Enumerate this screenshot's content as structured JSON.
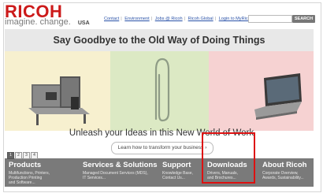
{
  "brand": {
    "logo": "RICOH",
    "tagline": "imagine. change.",
    "country": "USA",
    "logo_color": "#cc1a1a"
  },
  "topnav": {
    "links": [
      "Contact",
      "Environment",
      "Jobs @ Ricoh",
      "Ricoh Global",
      "Login to MyRicoh"
    ]
  },
  "search": {
    "value": "",
    "button_label": "SEARCH"
  },
  "headline": "Say Goodbye to the Old Way of Doing Things",
  "hero": {
    "slogan": "Unleash your Ideas in this New World of Work",
    "cta": "Learn how to transform your business",
    "cta_arrow": "›",
    "panel_colors": [
      "#f7f0cf",
      "#dce9c4",
      "#f6d2d2"
    ],
    "pages": [
      "1",
      "2",
      "3",
      "4"
    ],
    "active_page": "1"
  },
  "tiles": [
    {
      "title": "Products",
      "desc": [
        "Multifunctions, Printers,",
        "Production Printing",
        "and Software..."
      ]
    },
    {
      "title": "Services & Solutions",
      "desc": [
        "Managed Document Services (MDS),",
        "IT Services..."
      ]
    },
    {
      "title": "Support",
      "desc": [
        "Knowledge Base,",
        "Contact Us..."
      ]
    },
    {
      "title": "Downloads",
      "desc": [
        "Drivers, Manuals,",
        "and Brochures..."
      ]
    },
    {
      "title": "About Ricoh",
      "desc": [
        "Corporate Overview,",
        "Awards, Sustainability..."
      ]
    }
  ],
  "highlight_color": "#dd1111"
}
